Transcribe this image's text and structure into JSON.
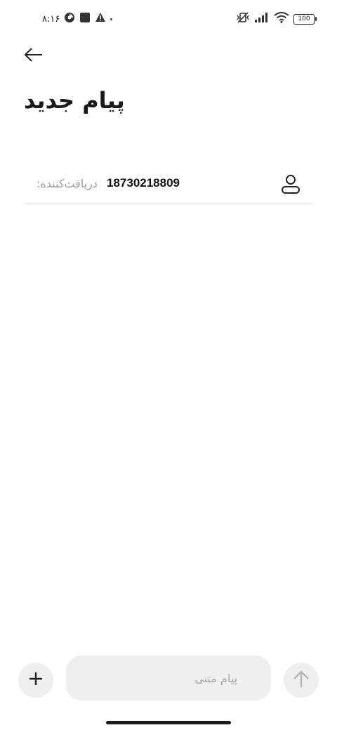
{
  "status_bar": {
    "time": "۸:۱۶",
    "battery_level": "100",
    "icons": [
      "data-saver-icon",
      "square-notification-icon",
      "warning-icon",
      "dot-icon",
      "vibrate-off-icon",
      "signal-icon",
      "wifi-icon",
      "battery-icon"
    ]
  },
  "header": {
    "back_icon": "arrow-left-icon",
    "title": "پیام جدید"
  },
  "recipient": {
    "label": "دریافت‌کننده:",
    "number": "18730218809",
    "contact_icon": "person-icon"
  },
  "composer": {
    "add_icon": "plus-icon",
    "placeholder": "پیام متنی",
    "send_icon": "arrow-up-icon"
  },
  "colors": {
    "background": "#ffffff",
    "control_bg": "#efefef",
    "text_primary": "#1a1a1a",
    "text_hint": "#9a9a9a",
    "divider": "#dcdcdc"
  }
}
